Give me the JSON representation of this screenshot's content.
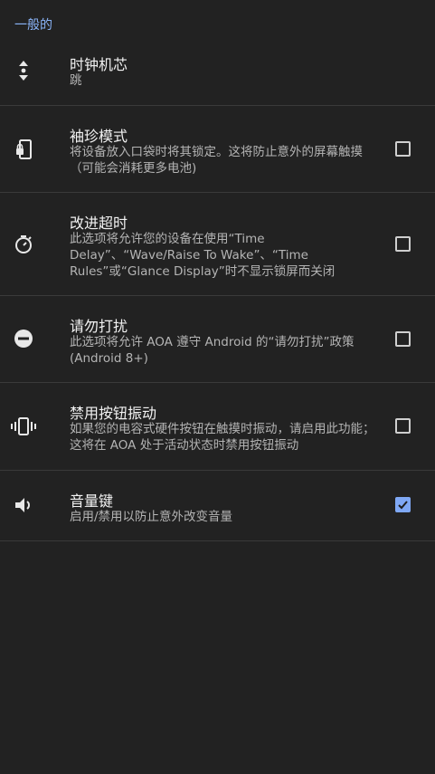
{
  "section_header": "一般的",
  "items": [
    {
      "title": "时钟机芯",
      "summary": "跳",
      "icon": "up-down-arrows-icon",
      "has_checkbox": false
    },
    {
      "title": "袖珍模式",
      "summary": "将设备放入口袋时将其锁定。这将防止意外的屏幕触摸（可能会消耗更多电池)",
      "icon": "phone-lock-icon",
      "has_checkbox": true,
      "checked": false
    },
    {
      "title": "改进超时",
      "summary": "此选项将允许您的设备在使用“Time Delay”、“Wave/Raise To Wake”、“Time Rules”或“Glance Display”时不显示锁屏而关闭",
      "icon": "timer-icon",
      "has_checkbox": true,
      "checked": false
    },
    {
      "title": "请勿打扰",
      "summary": "此选项将允许 AOA 遵守 Android 的“请勿打扰”政策 (Android 8+)",
      "icon": "do-not-disturb-icon",
      "has_checkbox": true,
      "checked": false
    },
    {
      "title": "禁用按钮振动",
      "summary": "如果您的电容式硬件按钮在触摸时振动，请启用此功能；这将在 AOA 处于活动状态时禁用按钮振动",
      "icon": "vibration-icon",
      "has_checkbox": true,
      "checked": false
    },
    {
      "title": "音量键",
      "summary": "启用/禁用以防止意外改变音量",
      "icon": "volume-icon",
      "has_checkbox": true,
      "checked": true
    }
  ],
  "colors": {
    "background": "#222222",
    "accent": "#8ab4f8",
    "checkbox_checked": "#7fa8f5",
    "divider": "#3a3a3a"
  }
}
